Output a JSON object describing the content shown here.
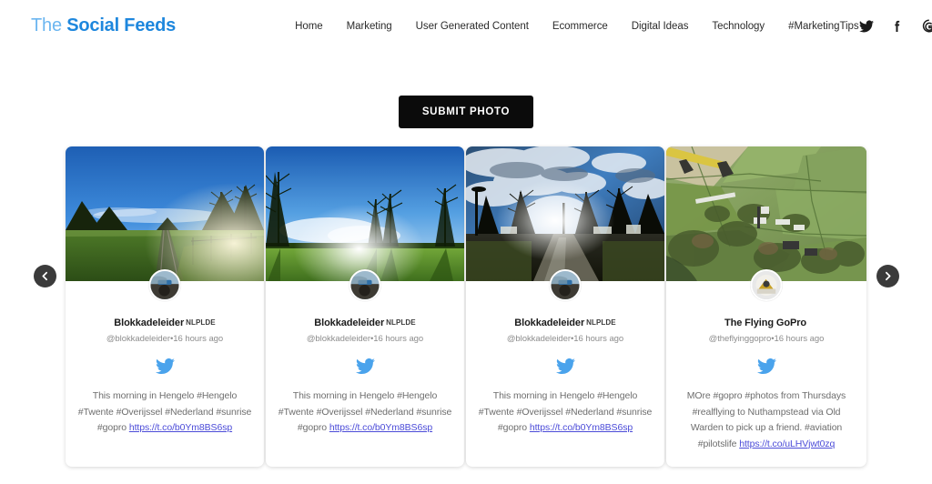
{
  "header": {
    "brand_the": "The ",
    "brand_main": "Social Feeds",
    "nav": [
      {
        "label": "Home"
      },
      {
        "label": "Marketing"
      },
      {
        "label": "User Generated Content"
      },
      {
        "label": "Ecommerce"
      },
      {
        "label": "Digital Ideas"
      },
      {
        "label": "Technology"
      },
      {
        "label": "#MarketingTips"
      }
    ],
    "social": [
      {
        "name": "twitter-icon"
      },
      {
        "name": "facebook-icon"
      },
      {
        "name": "google-icon"
      }
    ]
  },
  "actions": {
    "submit_photo_label": "SUBMIT PHOTO"
  },
  "carousel": {
    "prev_label": "Previous",
    "next_label": "Next",
    "cards": [
      {
        "username": "Blokkadeleider",
        "username_badge": "NLPLDE",
        "handle": "@blokkadeleider",
        "separator": "•",
        "timestamp": "16 hours ago",
        "network": "twitter",
        "text": "This morning in Hengelo #Hengelo #Twente #Overijssel #Nederland #sunrise #gopro ",
        "link": "https://t.co/b0Ym8BS6sp",
        "photo": "rural-railway-sunrise"
      },
      {
        "username": "Blokkadeleider",
        "username_badge": "NLPLDE",
        "handle": "@blokkadeleider",
        "separator": "•",
        "timestamp": "16 hours ago",
        "network": "twitter",
        "text": "This morning in Hengelo #Hengelo #Twente #Overijssel #Nederland #sunrise #gopro ",
        "link": "https://t.co/b0Ym8BS6sp",
        "photo": "green-field-bare-trees"
      },
      {
        "username": "Blokkadeleider",
        "username_badge": "NLPLDE",
        "handle": "@blokkadeleider",
        "separator": "•",
        "timestamp": "16 hours ago",
        "network": "twitter",
        "text": "This morning in Hengelo #Hengelo #Twente #Overijssel #Nederland #sunrise #gopro ",
        "link": "https://t.co/b0Ym8BS6sp",
        "photo": "dramatic-cloudy-path"
      },
      {
        "username": "The Flying GoPro",
        "username_badge": "",
        "handle": "@theflyinggopro",
        "separator": "•",
        "timestamp": "16 hours ago",
        "network": "twitter",
        "text": "MOre #gopro #photos from Thursdays #realflying to Nuthampstead via Old Warden to pick up a friend. #aviation #pilotslife ",
        "link": "https://t.co/uLHVjwt0zq",
        "photo": "aerial-countryside-from-plane"
      }
    ]
  },
  "colors": {
    "brand_light": "#6cb6f0",
    "brand_dark": "#1e87dd",
    "twitter_blue": "#4aa3ec",
    "link": "#4b4bd8",
    "button_bg": "#0b0b0b",
    "arrow_bg": "#3b3b3b"
  }
}
